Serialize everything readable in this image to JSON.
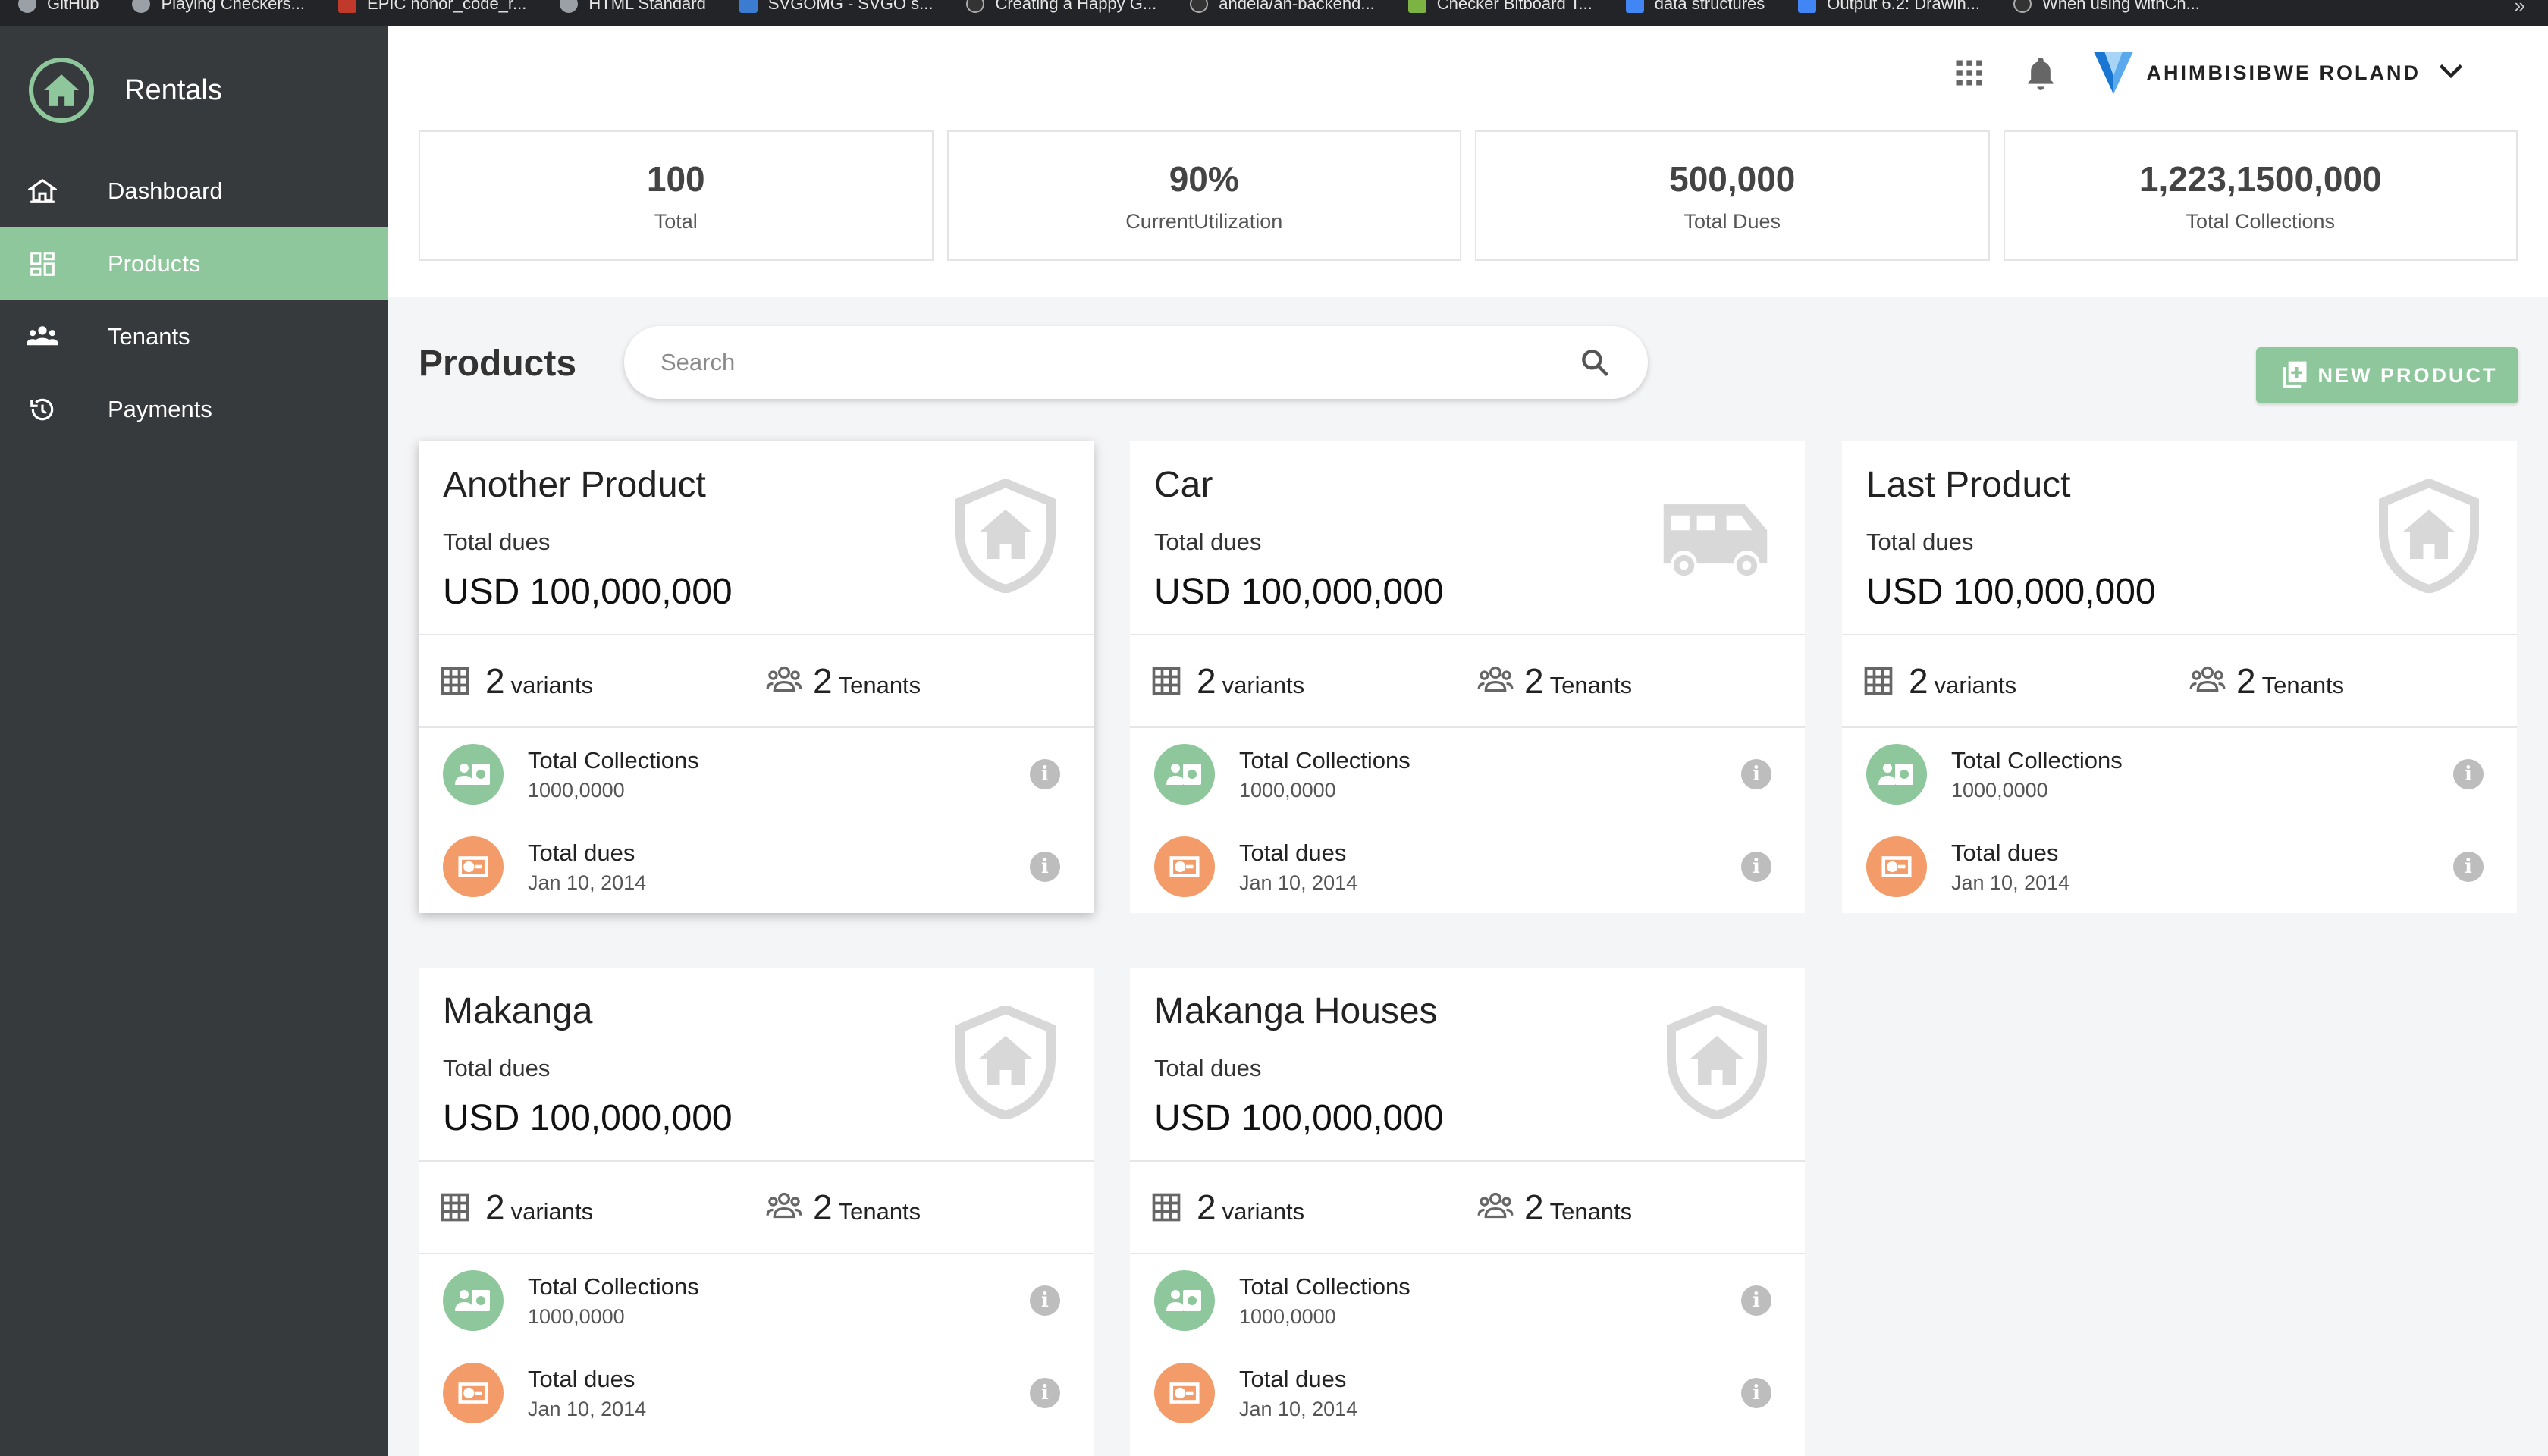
{
  "bookmarks": [
    "GitHub",
    "Playing Checkers...",
    "EPIC honor_code_r...",
    "HTML Standard",
    "SVGOMG - SVGO s...",
    "Creating a Happy G...",
    "andela/ah-backend...",
    "Checker Bitboard T...",
    "data structures",
    "Output 6.2: Drawin...",
    "When using withCh..."
  ],
  "bookmarks_more": "»",
  "sidebar": {
    "brand": "Rentals",
    "items": [
      {
        "label": "Dashboard",
        "icon": "home-icon",
        "active": false
      },
      {
        "label": "Products",
        "icon": "dashboard-grid-icon",
        "active": true
      },
      {
        "label": "Tenants",
        "icon": "people-icon",
        "active": false
      },
      {
        "label": "Payments",
        "icon": "history-icon",
        "active": false
      }
    ]
  },
  "header": {
    "user_name": "AHIMBISIBWE ROLAND"
  },
  "stats": [
    {
      "value": "100",
      "label": "Total"
    },
    {
      "value": "90%",
      "label": "CurrentUtilization"
    },
    {
      "value": "500,000",
      "label": "Total Dues"
    },
    {
      "value": "1,223,1500,000",
      "label": "Total Collections"
    }
  ],
  "products_bar": {
    "title": "Products",
    "search_placeholder": "Search",
    "new_button": "NEW PRODUCT"
  },
  "cards": [
    {
      "title": "Another Product",
      "dues_label": "Total dues",
      "amount": "USD 100,000,000",
      "illustration": "shield-home-icon",
      "variants_count": "2",
      "variants_label": "variants",
      "tenants_count": "2",
      "tenants_label": "Tenants",
      "collections_label": "Total Collections",
      "collections_value": "1000,0000",
      "dues_row_label": "Total dues",
      "dues_date": "Jan 10, 2014"
    },
    {
      "title": "Car",
      "dues_label": "Total dues",
      "amount": "USD 100,000,000",
      "illustration": "truck-icon",
      "variants_count": "2",
      "variants_label": "variants",
      "tenants_count": "2",
      "tenants_label": "Tenants",
      "collections_label": "Total Collections",
      "collections_value": "1000,0000",
      "dues_row_label": "Total dues",
      "dues_date": "Jan 10, 2014"
    },
    {
      "title": "Last Product",
      "dues_label": "Total dues",
      "amount": "USD 100,000,000",
      "illustration": "shield-home-icon",
      "variants_count": "2",
      "variants_label": "variants",
      "tenants_count": "2",
      "tenants_label": "Tenants",
      "collections_label": "Total Collections",
      "collections_value": "1000,0000",
      "dues_row_label": "Total dues",
      "dues_date": "Jan 10, 2014"
    },
    {
      "title": "Makanga",
      "dues_label": "Total dues",
      "amount": "USD 100,000,000",
      "illustration": "shield-home-icon",
      "variants_count": "2",
      "variants_label": "variants",
      "tenants_count": "2",
      "tenants_label": "Tenants",
      "collections_label": "Total Collections",
      "collections_value": "1000,0000",
      "dues_row_label": "Total dues",
      "dues_date": "Jan 10, 2014"
    },
    {
      "title": "Makanga Houses",
      "dues_label": "Total dues",
      "amount": "USD 100,000,000",
      "illustration": "shield-home-icon",
      "variants_count": "2",
      "variants_label": "variants",
      "tenants_count": "2",
      "tenants_label": "Tenants",
      "collections_label": "Total Collections",
      "collections_value": "1000,0000",
      "dues_row_label": "Total dues",
      "dues_date": "Jan 10, 2014"
    }
  ],
  "colors": {
    "accent": "#8ec79b",
    "sidebar": "#373a3c",
    "orange": "#f39c69",
    "info_grey": "#bdbdbd"
  }
}
